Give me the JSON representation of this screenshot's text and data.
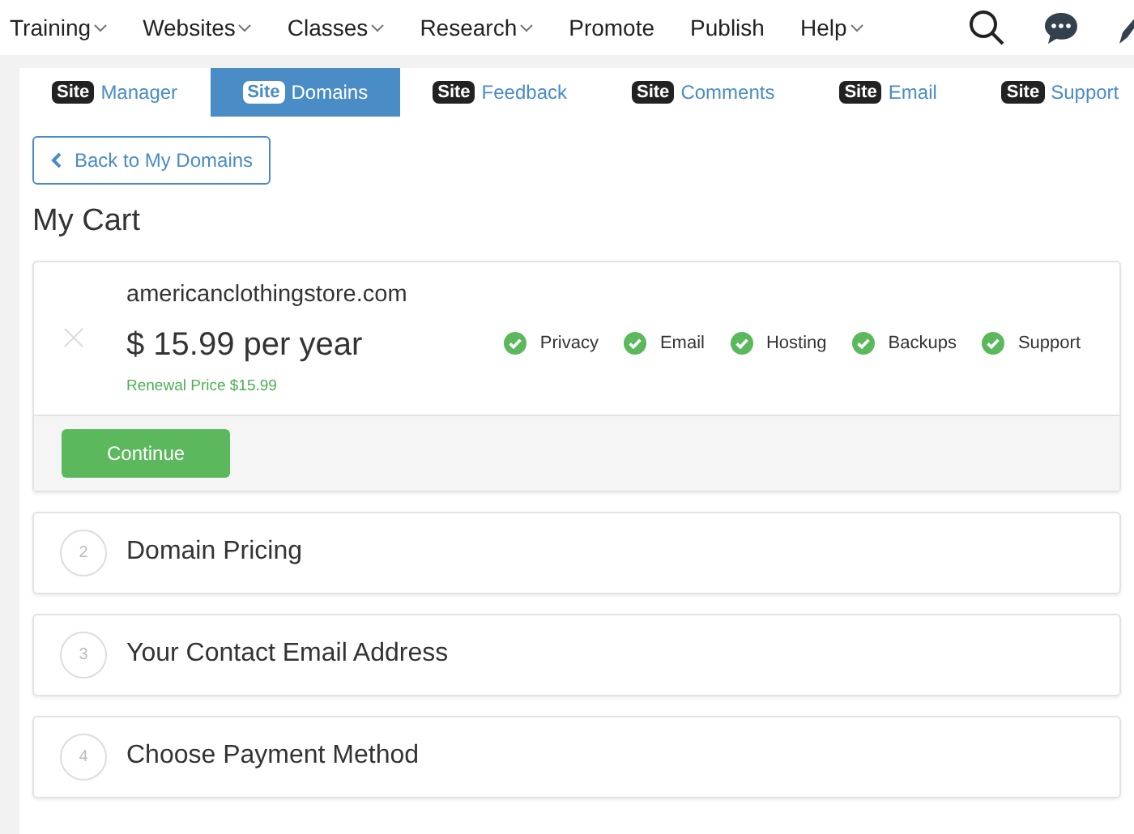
{
  "top_menu": [
    {
      "label": "Training",
      "has_menu": true
    },
    {
      "label": "Websites",
      "has_menu": true
    },
    {
      "label": "Classes",
      "has_menu": true
    },
    {
      "label": "Research",
      "has_menu": true
    },
    {
      "label": "Promote",
      "has_menu": false
    },
    {
      "label": "Publish",
      "has_menu": false
    },
    {
      "label": "Help",
      "has_menu": true
    }
  ],
  "tabs": [
    {
      "badge": "Site",
      "label": "Manager",
      "selected": false
    },
    {
      "badge": "Site",
      "label": "Domains",
      "selected": true
    },
    {
      "badge": "Site",
      "label": "Feedback",
      "selected": false
    },
    {
      "badge": "Site",
      "label": "Comments",
      "selected": false
    },
    {
      "badge": "Site",
      "label": "Email",
      "selected": false
    },
    {
      "badge": "Site",
      "label": "Support",
      "selected": false
    }
  ],
  "back_button": "Back to My Domains",
  "heading": "My Cart",
  "cart_item": {
    "domain": "americanclothingstore.com",
    "price": "$ 15.99 per year",
    "renewal": "Renewal Price $15.99",
    "features": [
      "Privacy",
      "Email",
      "Hosting",
      "Backups",
      "Support"
    ],
    "button": "Continue"
  },
  "steps": [
    {
      "number": "2",
      "title": "Domain Pricing"
    },
    {
      "number": "3",
      "title": "Your Contact Email Address"
    },
    {
      "number": "4",
      "title": "Choose Payment Method"
    }
  ]
}
